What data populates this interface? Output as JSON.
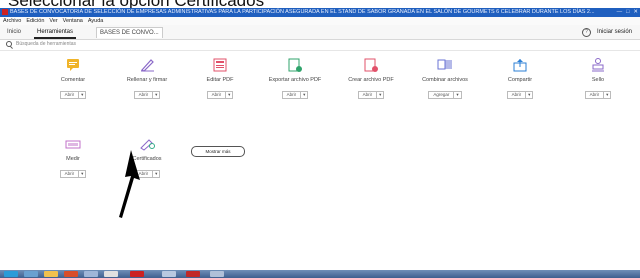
{
  "heading": "Seleccionar la opción Certificados",
  "window": {
    "title": "BASES DE CONVOCATORIA DE SELECCIÓN DE EMPRESAS ADMINISTRATIVAS PARA LA PARTICIPACIÓN ASEGURADA EN EL STAND DE SABOR GRANADA EN EL SALÓN DE GOURMETS 6 CELEBRAR DURANTE LOS DÍAS 2...",
    "controls": [
      "—",
      "□",
      "✕"
    ]
  },
  "menu": [
    "Archivo",
    "Edición",
    "Ver",
    "Ventana",
    "Ayuda"
  ],
  "tabs": {
    "home": "Inicio",
    "tools": "Herramientas",
    "document": "BASES DE CONVO..."
  },
  "signin": "Iniciar sesión",
  "help_glyph": "?",
  "search": {
    "placeholder": "Búsqueda de herramientas"
  },
  "tools": [
    {
      "name": "Comentar",
      "dropdown": "Abrir",
      "icon": "comment-icon",
      "color": "#f0b429"
    },
    {
      "name": "Rellenar y firmar",
      "dropdown": "Abrir",
      "icon": "fill-sign-icon",
      "color": "#8a68c8"
    },
    {
      "name": "Editar PDF",
      "dropdown": "Abrir",
      "icon": "edit-pdf-icon",
      "color": "#e2516a"
    },
    {
      "name": "Exportar archivo PDF",
      "dropdown": "Abrir",
      "icon": "export-pdf-icon",
      "color": "#2fa36b"
    },
    {
      "name": "Crear archivo PDF",
      "dropdown": "Abrir",
      "icon": "create-pdf-icon",
      "color": "#e2516a"
    },
    {
      "name": "Combinar archivos",
      "dropdown": "Agregar",
      "icon": "combine-files-icon",
      "color": "#6a73d4"
    },
    {
      "name": "Compartir",
      "dropdown": "Abrir",
      "icon": "share-icon",
      "color": "#2b7fd6"
    },
    {
      "name": "Sello",
      "dropdown": "Abrir",
      "icon": "stamp-icon",
      "color": "#8a68c8"
    },
    {
      "name": "Medir",
      "dropdown": "Abrir",
      "icon": "measure-icon",
      "color": "#c070c8"
    },
    {
      "name": "Certificados",
      "dropdown": "Abrir",
      "icon": "certificates-icon",
      "color": "#8a68c8"
    }
  ],
  "more_button": "Mostrar más",
  "caret": "▾"
}
